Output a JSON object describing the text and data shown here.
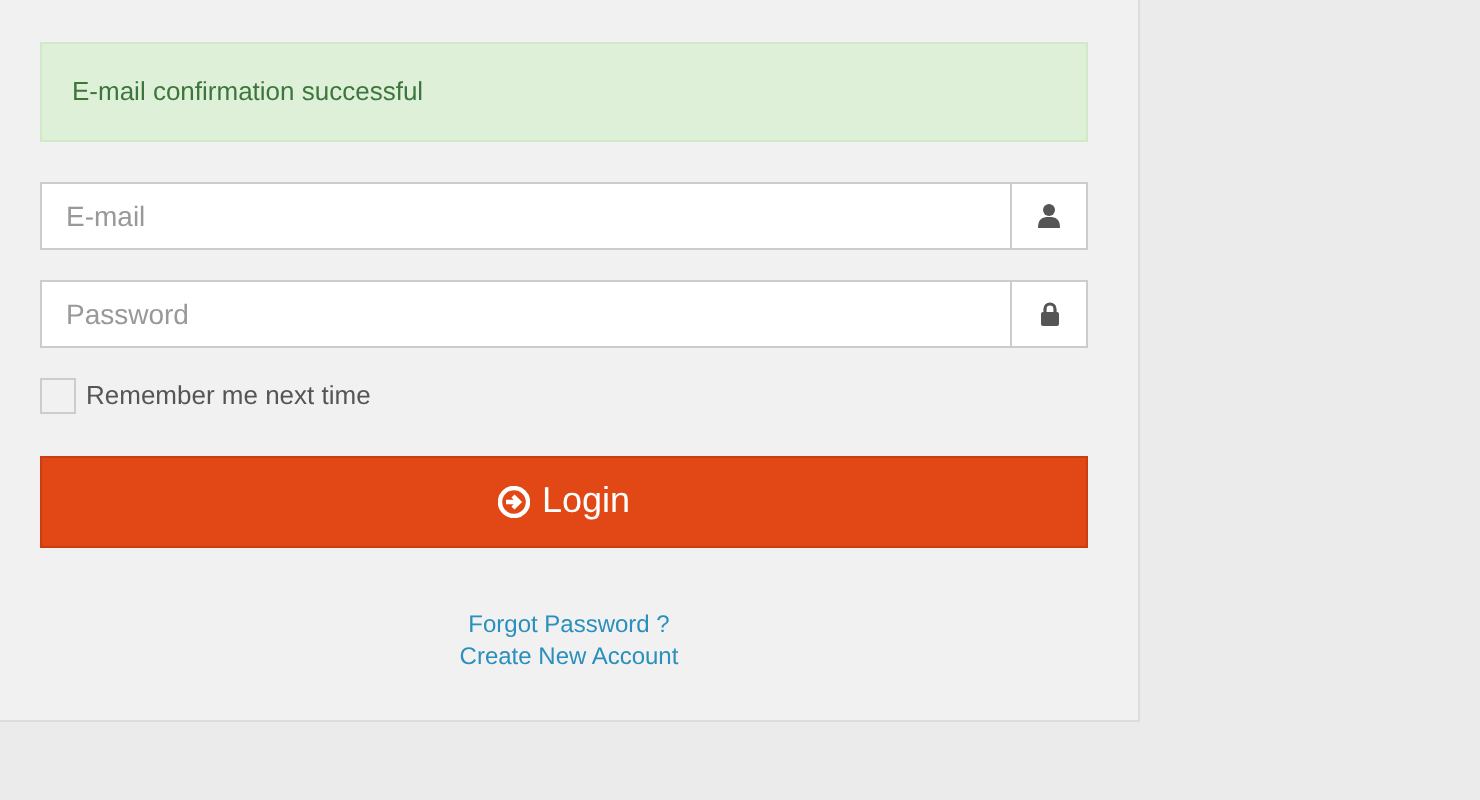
{
  "alert": {
    "text": "E-mail confirmation successful"
  },
  "fields": [
    {
      "kind": "email",
      "placeholder": "E-mail"
    },
    {
      "kind": "password",
      "placeholder": "Password"
    }
  ],
  "remember": {
    "label": "Remember me next time",
    "checked": false
  },
  "login_button": {
    "label": "Login"
  },
  "links": [
    "Forgot Password ?",
    "Create New Account"
  ]
}
